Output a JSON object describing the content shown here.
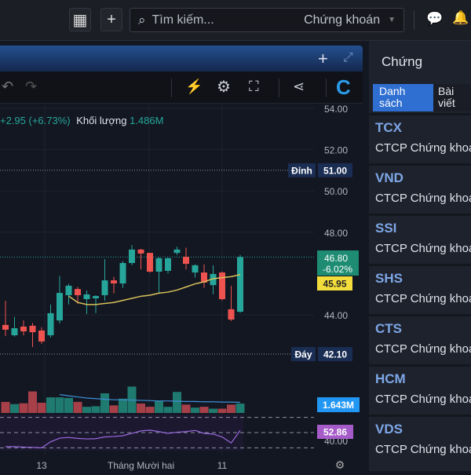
{
  "topbar": {
    "search_placeholder": "Tìm kiếm...",
    "search_category": "Chứng khoán",
    "icons": [
      "grid-icon",
      "plus-icon",
      "search-icon",
      "chat-icon",
      "bell-icon"
    ]
  },
  "legend": {
    "change": "+2.95 (+6.73%)",
    "volume_label": "Khối lượng",
    "volume_value": "1.486M"
  },
  "right_panel": {
    "title": "Chứng",
    "tabs": [
      "Danh sách",
      "Bài viết"
    ],
    "items": [
      {
        "symbol": "TCX",
        "name": "CTCP Chứng khoán"
      },
      {
        "symbol": "VND",
        "name": "CTCP Chứng khoán"
      },
      {
        "symbol": "SSI",
        "name": "CTCP Chứng khoán"
      },
      {
        "symbol": "SHS",
        "name": "CTCP Chứng khoán"
      },
      {
        "symbol": "CTS",
        "name": "CTCP Chứng khoán"
      },
      {
        "symbol": "HCM",
        "name": "CTCP Chứng khoán"
      },
      {
        "symbol": "VDS",
        "name": "CTCP Chứng khoán"
      }
    ]
  },
  "colors": {
    "up": "#26a69a",
    "down": "#ef5350",
    "ma": "#d8c25a",
    "vol_ma": "#3d8fd6",
    "rsi": "#9c6ade"
  },
  "chart_data": {
    "type": "candlestick",
    "price_ticks": [
      "54.00",
      "52.00",
      "50.00",
      "48.00",
      "44.00"
    ],
    "price_tick_values": [
      54,
      52,
      50,
      48,
      44
    ],
    "ylim": [
      40.3,
      54.3
    ],
    "x_labels": [
      {
        "text": "13",
        "index": 4
      },
      {
        "text": "Tháng Mười hai",
        "index": 15
      },
      {
        "text": "11",
        "index": 24
      }
    ],
    "ohlc": [
      [
        43.51,
        44.68,
        42.97,
        43.28
      ],
      [
        43.01,
        43.9,
        42.95,
        43.35
      ],
      [
        43.43,
        43.73,
        43.0,
        43.2
      ],
      [
        43.47,
        43.6,
        42.44,
        43.16
      ],
      [
        43.24,
        43.4,
        42.6,
        42.71
      ],
      [
        43.01,
        44.5,
        42.9,
        44.08
      ],
      [
        43.73,
        45.88,
        43.58,
        45.06
      ],
      [
        44.95,
        45.5,
        44.5,
        45.41
      ],
      [
        45.25,
        45.35,
        44.53,
        44.95
      ],
      [
        44.76,
        45.18,
        44.04,
        44.99
      ],
      [
        44.8,
        44.95,
        44.08,
        44.91
      ],
      [
        44.95,
        46.7,
        44.68,
        45.67
      ],
      [
        45.67,
        45.85,
        45.03,
        45.52
      ],
      [
        45.52,
        46.6,
        45.3,
        46.51
      ],
      [
        46.51,
        47.38,
        46.4,
        47.16
      ],
      [
        47.16,
        47.2,
        46.2,
        46.97
      ],
      [
        47.0,
        47.0,
        46.05,
        46.09
      ],
      [
        46.09,
        46.8,
        45.06,
        46.74
      ],
      [
        46.13,
        46.78,
        46.0,
        46.74
      ],
      [
        47.0,
        47.3,
        46.9,
        47.16
      ],
      [
        46.81,
        47.25,
        46.2,
        46.47
      ],
      [
        46.05,
        46.45,
        45.8,
        46.4
      ],
      [
        46.05,
        46.45,
        45.3,
        45.56
      ],
      [
        45.44,
        46.4,
        45.0,
        45.98
      ],
      [
        46.05,
        46.1,
        44.7,
        44.76
      ],
      [
        44.27,
        45.4,
        43.7,
        43.77
      ],
      [
        44.15,
        46.9,
        44.1,
        46.8
      ]
    ],
    "ma": [
      null,
      null,
      null,
      null,
      null,
      null,
      null,
      44.91,
      44.6,
      44.5,
      44.5,
      44.55,
      44.6,
      44.7,
      44.8,
      44.9,
      44.95,
      45.05,
      45.1,
      45.2,
      45.35,
      45.5,
      45.6,
      45.75,
      45.8,
      45.85,
      45.95
    ],
    "volume_m": [
      1.93,
      1.55,
      1.69,
      3.76,
      1.79,
      2.73,
      2.73,
      2.63,
      1.93,
      1.08,
      1.18,
      3.43,
      1.32,
      2.49,
      4.61,
      1.65,
      1.08,
      2.16,
      1.08,
      3.67,
      1.46,
      0.94,
      1.08,
      0.75,
      0.75,
      1.46,
      1.643
    ],
    "volume_ma_m": [
      null,
      null,
      null,
      null,
      null,
      null,
      3.2,
      3.0,
      2.8,
      2.6,
      2.5,
      2.4,
      2.3,
      2.3,
      2.25,
      2.2,
      2.15,
      2.1,
      2.1,
      2.05,
      2.0,
      2.0,
      1.95,
      1.95,
      1.9,
      1.9,
      1.85
    ],
    "rsi": [
      31.6,
      31.6,
      31,
      30.6,
      30,
      38,
      42.7,
      43.6,
      42.4,
      41.7,
      42,
      44.3,
      44.9,
      45.9,
      49,
      52.2,
      53.2,
      51.3,
      49,
      50.6,
      51.3,
      52.9,
      49,
      48.1,
      44.3,
      36.4,
      52.86
    ],
    "rsi_levels": [
      70,
      50,
      30
    ],
    "labels": {
      "top_tag": "Đỉnh",
      "top_value": "51.00",
      "top": 51.0,
      "bottom_tag": "Đáy",
      "bottom_value": "42.10",
      "bottom": 42.1,
      "last_price": "46.80",
      "last": 46.8,
      "last_change": "-6.02%",
      "ma_value": "45.95",
      "ma_last": 45.95,
      "volume_value": "1.643M",
      "rsi_value": "52.86",
      "rsi_tick": "40.00",
      "vol_tick": "40.00"
    }
  }
}
